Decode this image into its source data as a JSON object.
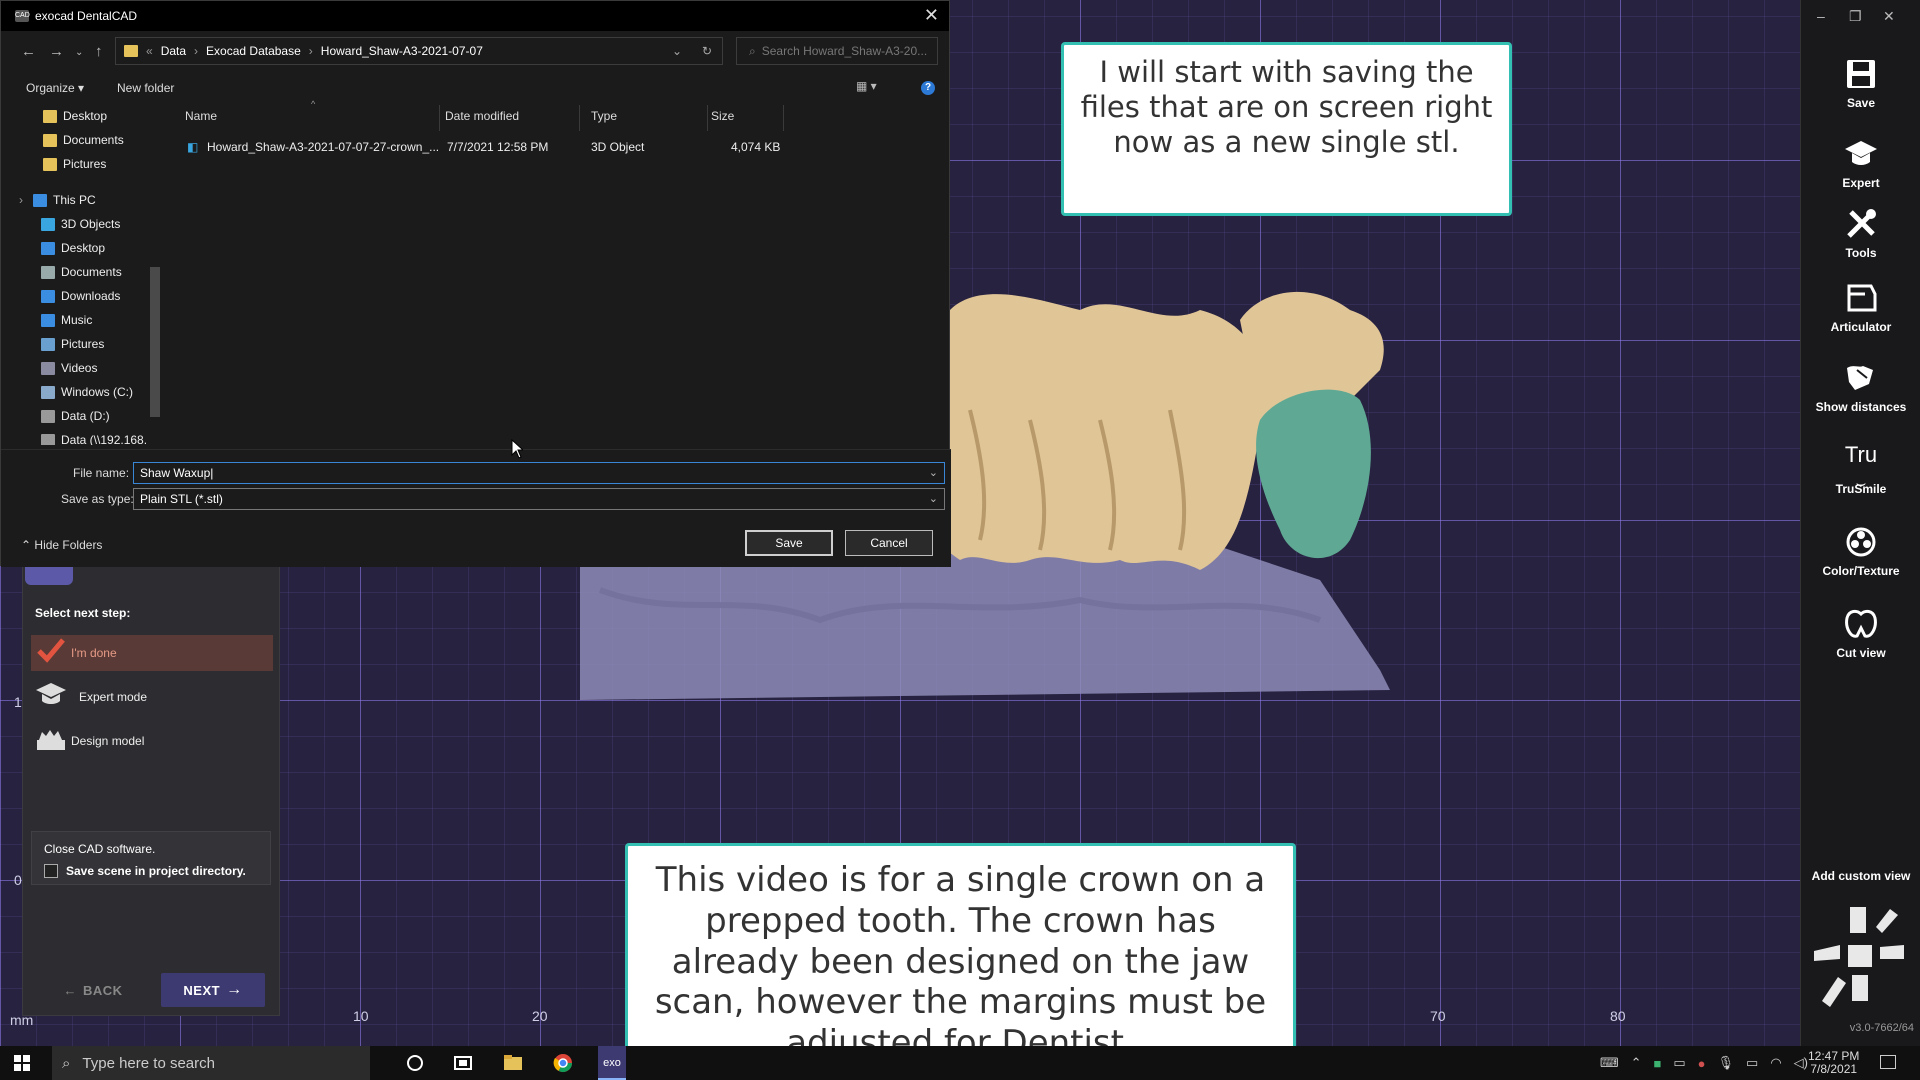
{
  "dialog": {
    "title": "exocad DentalCAD",
    "app_icon_text": "CAD",
    "breadcrumb": [
      "Data",
      "Exocad Database",
      "Howard_Shaw-A3-2021-07-07"
    ],
    "breadcrumb_prefix": "«",
    "search_placeholder": "Search Howard_Shaw-A3-20...",
    "organize_label": "Organize ▾",
    "new_folder_label": "New folder",
    "nav_items": [
      {
        "label": "Desktop",
        "color": "#e6c35a"
      },
      {
        "label": "Documents",
        "color": "#e6c35a"
      },
      {
        "label": "Pictures",
        "color": "#e6c35a"
      },
      {
        "label": "This PC",
        "color": "#3a8de0"
      },
      {
        "label": "3D Objects",
        "color": "#3aa6e0"
      },
      {
        "label": "Desktop",
        "color": "#3a8de0"
      },
      {
        "label": "Documents",
        "color": "#9aa"
      },
      {
        "label": "Downloads",
        "color": "#3a8de0"
      },
      {
        "label": "Music",
        "color": "#3a8de0"
      },
      {
        "label": "Pictures",
        "color": "#6aa0d0"
      },
      {
        "label": "Videos",
        "color": "#8a8aa0"
      },
      {
        "label": "Windows (C:)",
        "color": "#8aaacc"
      },
      {
        "label": "Data (D:)",
        "color": "#999"
      },
      {
        "label": "Data (\\\\192.168.",
        "color": "#999"
      }
    ],
    "columns": {
      "name": "Name",
      "date": "Date modified",
      "type": "Type",
      "size": "Size"
    },
    "files": [
      {
        "name": "Howard_Shaw-A3-2021-07-07-27-crown_...",
        "date": "7/7/2021 12:58 PM",
        "type": "3D Object",
        "size": "4,074 KB"
      }
    ],
    "file_name_label": "File name:",
    "file_name_value": "Shaw Waxup",
    "save_type_label": "Save as type:",
    "save_type_value": "Plain STL (*.stl)",
    "hide_folders_label": "Hide Folders",
    "save_label": "Save",
    "cancel_label": "Cancel"
  },
  "wizard": {
    "select_title": "Select next step:",
    "steps": [
      {
        "label": "I'm done",
        "icon": "check-icon"
      },
      {
        "label": "Expert mode",
        "icon": "graduation-cap-icon"
      },
      {
        "label": "Design model",
        "icon": "model-icon"
      }
    ],
    "close_text": "Close CAD software.",
    "save_scene_label": "Save scene in project directory.",
    "back_label": "BACK",
    "next_label": "NEXT"
  },
  "toolbar": {
    "tools": [
      "Save",
      "Expert",
      "Tools",
      "Articulator",
      "Show distances",
      "TruSmile",
      "Color/Texture",
      "Cut view"
    ],
    "tru_glyph": "Tru",
    "add_custom_view": "Add custom view",
    "version": "v3.0-7662/64"
  },
  "ruler": {
    "unit": "mm",
    "x_ticks": [
      "10",
      "20",
      "70",
      "80"
    ],
    "y_ticks": [
      "1",
      "0"
    ]
  },
  "captions": {
    "top": "I will start with saving the files that are on screen right now as a new single stl.",
    "bottom": "This video is for a single crown on a prepped tooth. The crown has already been designed on the jaw scan, however the margins must be adjusted for Dentist."
  },
  "taskbar": {
    "search_placeholder": "Type here to search",
    "exo_label": "exo",
    "time": "12:47 PM",
    "date": "7/8/2021"
  },
  "colors": {
    "accent_teal": "#33c0b2",
    "wizard_next": "#3d3a72",
    "active_step": "#5a3a36",
    "crown": "#5fa994",
    "model": "#e0c596",
    "base": "#8e8cb8"
  }
}
